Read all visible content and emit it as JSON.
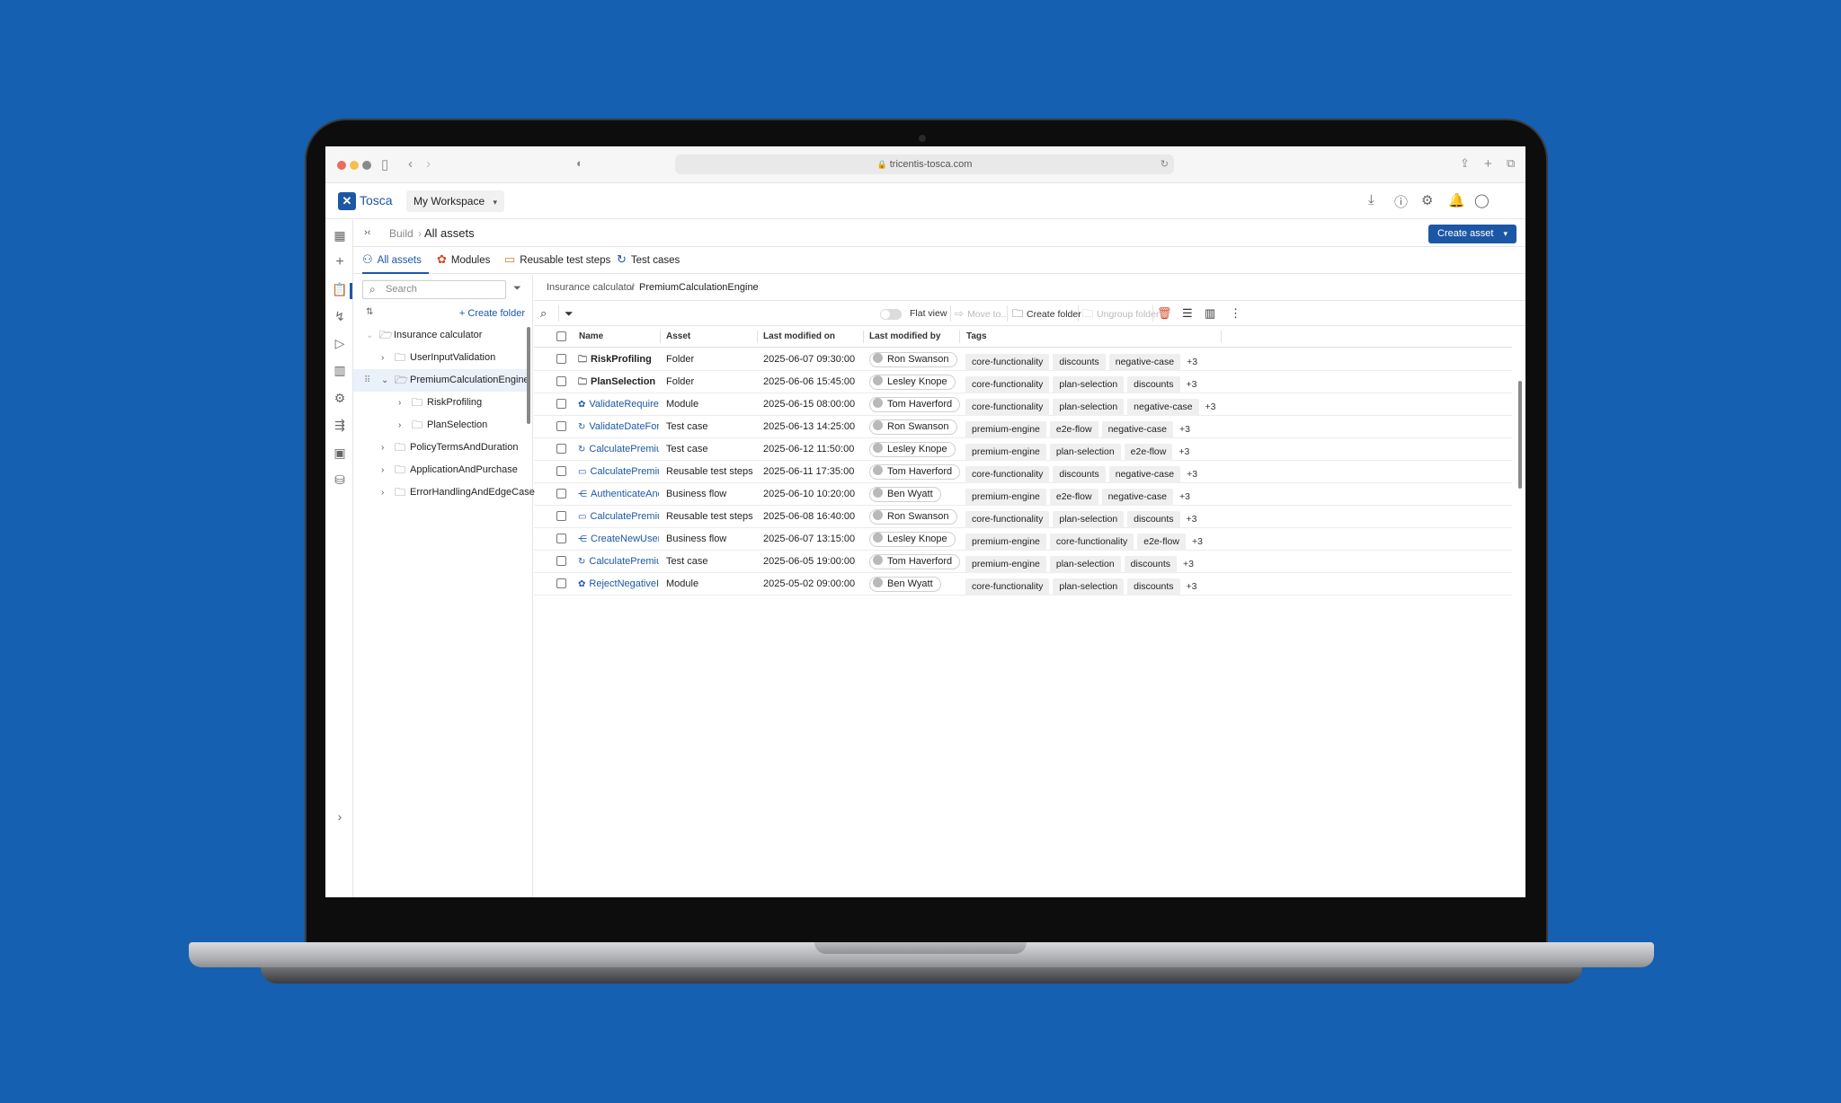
{
  "browser": {
    "url": "tricentis-tosca.com"
  },
  "app": {
    "logo": "Tosca",
    "workspace": "My Workspace"
  },
  "breadcrumb": {
    "build": "Build",
    "current": "All assets"
  },
  "create_asset_label": "Create asset",
  "tabs": [
    {
      "label": "All assets",
      "icon": "assets-icon",
      "color": "#1c57a6"
    },
    {
      "label": "Modules",
      "icon": "module-icon",
      "color": "#d14a2a"
    },
    {
      "label": "Reusable test steps",
      "icon": "reusable-steps-icon",
      "color": "#d17a2a"
    },
    {
      "label": "Test cases",
      "icon": "test-case-icon",
      "color": "#1c57a6"
    }
  ],
  "tree": {
    "search_placeholder": "Search",
    "create_folder": "Create folder",
    "items": [
      {
        "label": "Insurance calculator"
      },
      {
        "label": "UserInputValidation"
      },
      {
        "label": "PremiumCalculationEngine"
      },
      {
        "label": "RiskProfiling"
      },
      {
        "label": "PlanSelection"
      },
      {
        "label": "PolicyTermsAndDuration"
      },
      {
        "label": "ApplicationAndPurchase"
      },
      {
        "label": "ErrorHandlingAndEdgeCase"
      }
    ]
  },
  "main_path": {
    "parent": "Insurance calculator",
    "sep": "/",
    "current": "PremiumCalculationEngine"
  },
  "toolbar": {
    "flat_view": "Flat view",
    "move_to": "Move to...",
    "create_folder": "Create folder",
    "ungroup_folder": "Ungroup folder"
  },
  "table": {
    "headers": {
      "name": "Name",
      "asset": "Asset",
      "modified_on": "Last modified on",
      "modified_by": "Last modified by",
      "tags": "Tags"
    },
    "rows": [
      {
        "name": "RiskProfiling",
        "asset": "Folder",
        "date": "2025-06-07 09:30:00",
        "user": "Ron Swanson",
        "initials": "RS",
        "tags": [
          "core-functionality",
          "discounts",
          "negative-case"
        ],
        "more": "+3"
      },
      {
        "name": "PlanSelection",
        "asset": "Folder",
        "date": "2025-06-06 15:45:00",
        "user": "Lesley Knope",
        "initials": "LK",
        "tags": [
          "core-functionality",
          "plan-selection",
          "discounts"
        ],
        "more": "+3"
      },
      {
        "name": "ValidateRequired",
        "asset": "Module",
        "date": "2025-06-15 08:00:00",
        "user": "Tom Haverford",
        "initials": "TH",
        "tags": [
          "core-functionality",
          "plan-selection",
          "negative-case"
        ],
        "more": "+3"
      },
      {
        "name": "ValidateDateForm",
        "asset": "Test case",
        "date": "2025-06-13 14:25:00",
        "user": "Ron Swanson",
        "initials": "RS",
        "tags": [
          "premium-engine",
          "e2e-flow",
          "negative-case"
        ],
        "more": "+3"
      },
      {
        "name": "CalculatePremium",
        "asset": "Test case",
        "date": "2025-06-12 11:50:00",
        "user": "Lesley Knope",
        "initials": "LK",
        "tags": [
          "premium-engine",
          "plan-selection",
          "e2e-flow"
        ],
        "more": "+3"
      },
      {
        "name": "CalculatePremium",
        "asset": "Reusable test steps",
        "date": "2025-06-11 17:35:00",
        "user": "Tom Haverford",
        "initials": "TH",
        "tags": [
          "core-functionality",
          "discounts",
          "negative-case"
        ],
        "more": "+3"
      },
      {
        "name": "AuthenticateAnd",
        "asset": "Business flow",
        "date": "2025-06-10 10:20:00",
        "user": "Ben Wyatt",
        "initials": "BW",
        "tags": [
          "premium-engine",
          "e2e-flow",
          "negative-case"
        ],
        "more": "+3"
      },
      {
        "name": "CalculatePremium",
        "asset": "Reusable test steps",
        "date": "2025-06-08 16:40:00",
        "user": "Ron Swanson",
        "initials": "RS",
        "tags": [
          "core-functionality",
          "plan-selection",
          "discounts"
        ],
        "more": "+3"
      },
      {
        "name": "CreateNewUserA",
        "asset": "Business flow",
        "date": "2025-06-07 13:15:00",
        "user": "Lesley Knope",
        "initials": "LK",
        "tags": [
          "premium-engine",
          "core-functionality",
          "e2e-flow"
        ],
        "more": "+3"
      },
      {
        "name": "CalculatePremium",
        "asset": "Test case",
        "date": "2025-06-05 19:00:00",
        "user": "Tom Haverford",
        "initials": "TH",
        "tags": [
          "premium-engine",
          "plan-selection",
          "discounts"
        ],
        "more": "+3"
      },
      {
        "name": "RejectNegativeIn",
        "asset": "Module",
        "date": "2025-05-02 09:00:00",
        "user": "Ben Wyatt",
        "initials": "BW",
        "tags": [
          "core-functionality",
          "plan-selection",
          "discounts"
        ],
        "more": "+3"
      }
    ]
  },
  "colors": {
    "background": "#1560b0",
    "accent": "#1c57a6",
    "delete": "#d14a2a"
  }
}
